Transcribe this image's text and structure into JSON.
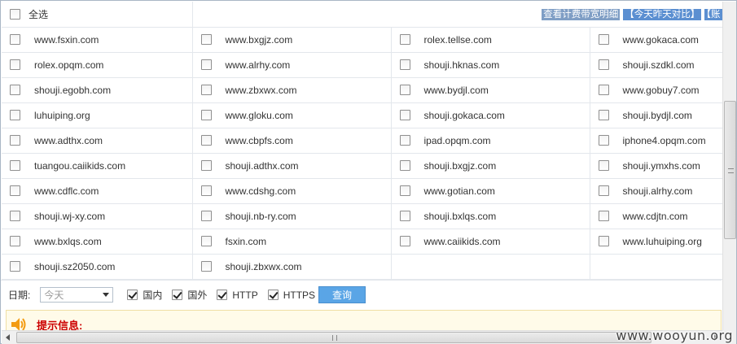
{
  "header": {
    "select_all_label": "全选",
    "links": [
      "查看计费带宽明细",
      "【今天昨天对比】",
      "【账"
    ]
  },
  "domains": [
    [
      "www.fsxin.com",
      "www.bxgjz.com",
      "rolex.tellse.com",
      "www.gokaca.com"
    ],
    [
      "rolex.opqm.com",
      "www.alrhy.com",
      "shouji.hknas.com",
      "shouji.szdkl.com"
    ],
    [
      "shouji.egobh.com",
      "www.zbxwx.com",
      "www.bydjl.com",
      "www.gobuy7.com"
    ],
    [
      "luhuiping.org",
      "www.gloku.com",
      "shouji.gokaca.com",
      "shouji.bydjl.com"
    ],
    [
      "www.adthx.com",
      "www.cbpfs.com",
      "ipad.opqm.com",
      "iphone4.opqm.com"
    ],
    [
      "tuangou.caiikids.com",
      "shouji.adthx.com",
      "shouji.bxgjz.com",
      "shouji.ymxhs.com"
    ],
    [
      "www.cdflc.com",
      "www.cdshg.com",
      "www.gotian.com",
      "shouji.alrhy.com"
    ],
    [
      "shouji.wj-xy.com",
      "shouji.nb-ry.com",
      "shouji.bxlqs.com",
      "www.cdjtn.com"
    ],
    [
      "www.bxlqs.com",
      "fsxin.com",
      "www.caiikids.com",
      "www.luhuiping.org"
    ],
    [
      "shouji.sz2050.com",
      "shouji.zbxwx.com",
      "",
      ""
    ]
  ],
  "filter": {
    "date_label": "日期:",
    "date_placeholder": "今天",
    "options": [
      {
        "label": "国内",
        "checked": true
      },
      {
        "label": "国外",
        "checked": true
      },
      {
        "label": "HTTP",
        "checked": true
      },
      {
        "label": "HTTPS",
        "checked": true
      }
    ],
    "query_button": "查询"
  },
  "tip": {
    "title": "提示信息:",
    "icon": "speaker-icon"
  },
  "watermark": "www.wooyun.org",
  "colors": {
    "accent": "#5aa5e6",
    "link_bg": "#5b8fd1",
    "tip_title": "#cc0000",
    "tip_bg": "#fffbe9"
  }
}
